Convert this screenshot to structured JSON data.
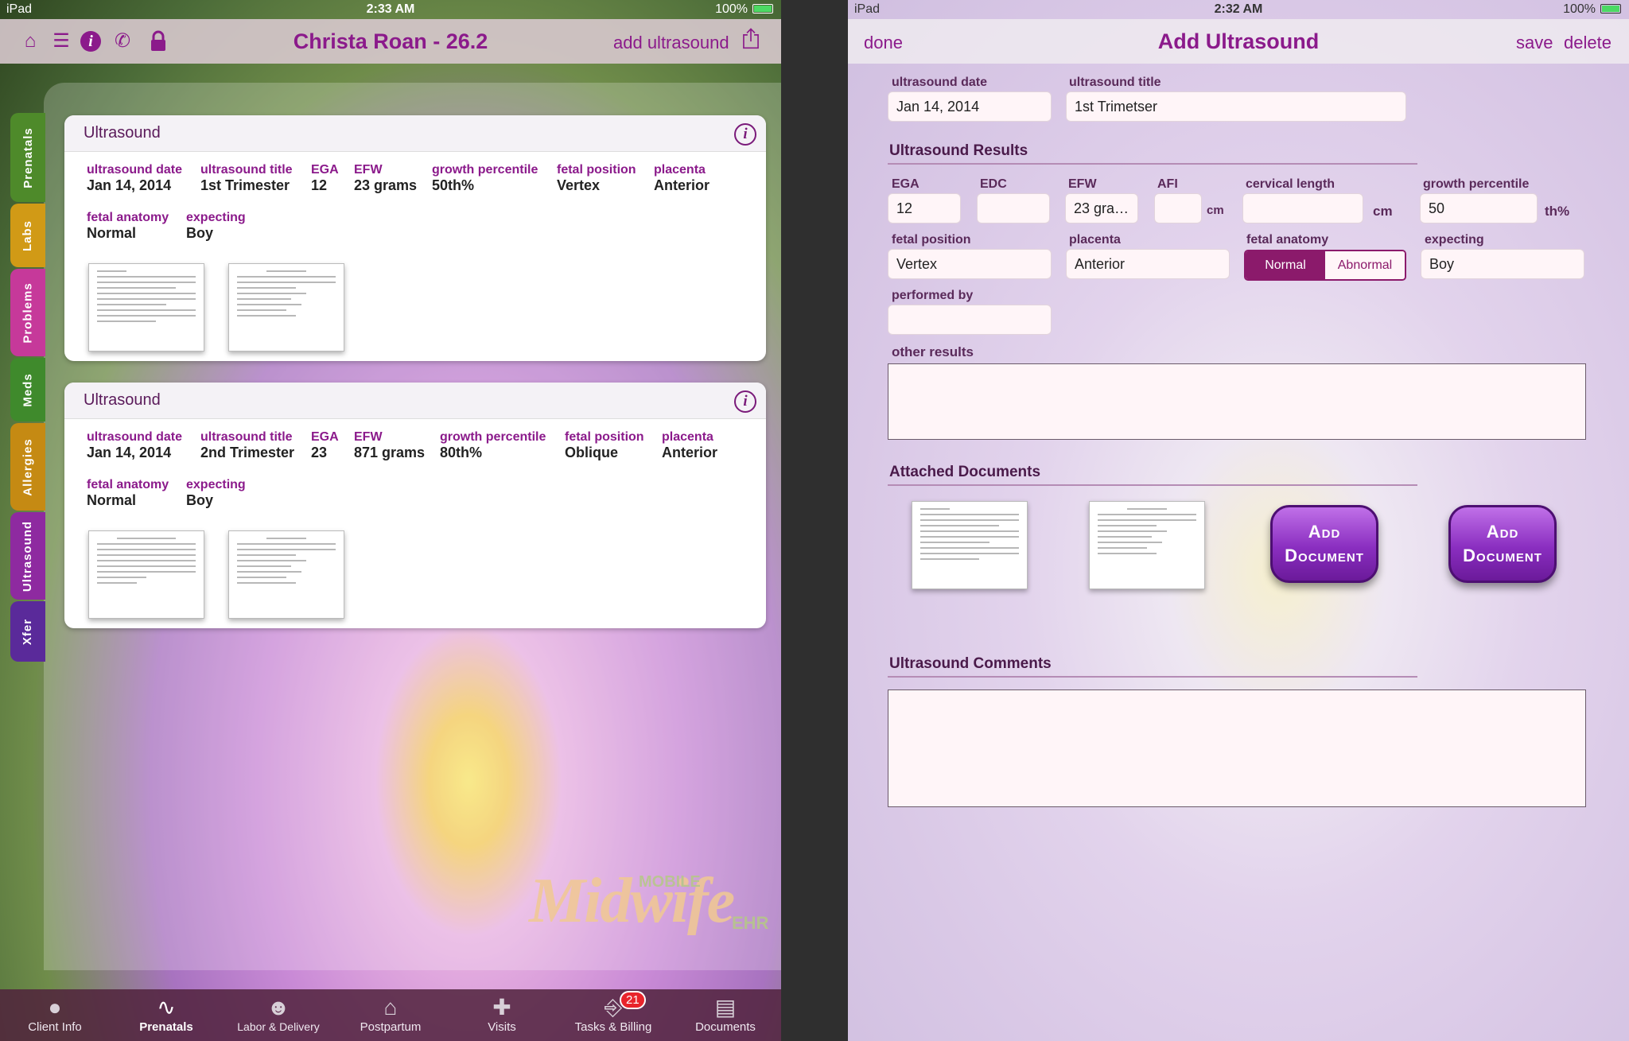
{
  "left": {
    "status": {
      "carrier": "iPad",
      "time": "2:33 AM",
      "battery": "100%"
    },
    "nav": {
      "title": "Christa Roan - 26.2",
      "action": "add ultrasound",
      "icons": [
        "home-icon",
        "list-icon",
        "info-icon",
        "phone-icon",
        "lock-icon",
        "share-icon"
      ]
    },
    "side_tabs": [
      "Prenatals",
      "Labs",
      "Problems",
      "Meds",
      "Allergies",
      "Ultrasound",
      "Xfer"
    ],
    "cards": [
      {
        "title": "Ultrasound",
        "fields": [
          {
            "label": "ultrasound date",
            "value": "Jan 14, 2014"
          },
          {
            "label": "ultrasound title",
            "value": "1st Trimester"
          },
          {
            "label": "EGA",
            "value": "12"
          },
          {
            "label": "EFW",
            "value": "23 grams"
          },
          {
            "label": "growth percentile",
            "value": "50th%"
          },
          {
            "label": "fetal position",
            "value": "Vertex"
          },
          {
            "label": "placenta",
            "value": "Anterior"
          },
          {
            "label": "fetal anatomy",
            "value": "Normal"
          },
          {
            "label": "expecting",
            "value": "Boy"
          }
        ]
      },
      {
        "title": "Ultrasound",
        "fields": [
          {
            "label": "ultrasound date",
            "value": "Jan 14, 2014"
          },
          {
            "label": "ultrasound title",
            "value": "2nd Trimester"
          },
          {
            "label": "EGA",
            "value": "23"
          },
          {
            "label": "EFW",
            "value": "871 grams"
          },
          {
            "label": "growth percentile",
            "value": "80th%"
          },
          {
            "label": "fetal position",
            "value": "Oblique"
          },
          {
            "label": "placenta",
            "value": "Anterior"
          },
          {
            "label": "fetal anatomy",
            "value": "Normal"
          },
          {
            "label": "expecting",
            "value": "Boy"
          }
        ]
      }
    ],
    "logo": {
      "big": "Midwife",
      "mobile": "MOBILE",
      "ehr": "EHR"
    },
    "tabbar": [
      {
        "label": "Client Info",
        "icon": "person-icon"
      },
      {
        "label": "Prenatals",
        "icon": "heartbeat-icon",
        "active": true
      },
      {
        "label": "Labor & Delivery",
        "icon": "baby-icon"
      },
      {
        "label": "Postpartum",
        "icon": "house-icon"
      },
      {
        "label": "Visits",
        "icon": "medkit-icon"
      },
      {
        "label": "Tasks & Billing",
        "icon": "tray-icon",
        "badge": "21"
      },
      {
        "label": "Documents",
        "icon": "cabinet-icon"
      }
    ]
  },
  "right": {
    "status": {
      "carrier": "iPad",
      "time": "2:32 AM",
      "battery": "100%"
    },
    "nav": {
      "title": "Add Ultrasound",
      "done": "done",
      "save": "save",
      "delete": "delete"
    },
    "form": {
      "date_label": "ultrasound date",
      "date_value": "Jan 14, 2014",
      "title_label": "ultrasound title",
      "title_value": "1st Trimetser",
      "results_heading": "Ultrasound Results",
      "ega_label": "EGA",
      "ega_value": "12",
      "edc_label": "EDC",
      "edc_value": "",
      "efw_label": "EFW",
      "efw_value": "23 gra…",
      "afi_label": "AFI",
      "afi_value": "",
      "afi_unit": "cm",
      "cervical_label": "cervical length",
      "cervical_value": "",
      "cervical_unit": "cm",
      "growth_label": "growth percentile",
      "growth_value": "50",
      "growth_unit": "th%",
      "position_label": "fetal position",
      "position_value": "Vertex",
      "placenta_label": "placenta",
      "placenta_value": "Anterior",
      "anatomy_label": "fetal anatomy",
      "anatomy_options": [
        "Normal",
        "Abnormal"
      ],
      "anatomy_selected": "Normal",
      "expecting_label": "expecting",
      "expecting_value": "Boy",
      "performed_label": "performed by",
      "performed_value": "",
      "other_label": "other results",
      "other_value": "",
      "docs_heading": "Attached Documents",
      "add_doc_label": "Add Document",
      "comments_heading": "Ultrasound Comments",
      "comments_value": ""
    }
  },
  "colors": {
    "accent": "#8b1a8b",
    "tab_prenatals": "#4e8a2a",
    "tab_labs": "#d19a16",
    "tab_problems": "#c6399a",
    "tab_meds": "#3f8a2c",
    "tab_allergies": "#c58a13",
    "tab_ultrasound": "#8e2aa0",
    "tab_xfer": "#5a2a9a"
  }
}
